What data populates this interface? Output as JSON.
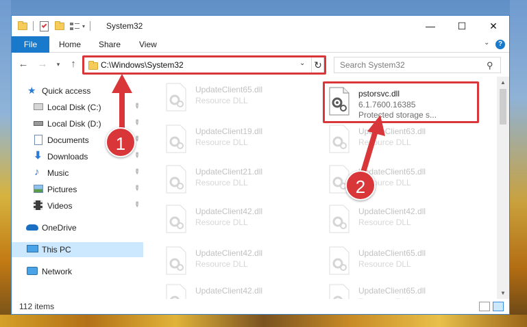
{
  "window": {
    "title": "System32",
    "controls": {
      "minimize": "—",
      "maximize": "☐",
      "close": "✕"
    }
  },
  "ribbon": {
    "tabs": [
      "File",
      "Home",
      "Share",
      "View"
    ],
    "help": "?"
  },
  "navigation": {
    "address": "C:\\Windows\\System32",
    "search_placeholder": "Search System32"
  },
  "sidebar": {
    "items": [
      {
        "label": "Quick access",
        "icon": "star-icon"
      },
      {
        "label": "Local Disk (C:)",
        "icon": "drive-icon",
        "pinned": true
      },
      {
        "label": "Local Disk (D:)",
        "icon": "drive-icon",
        "pinned": true
      },
      {
        "label": "Documents",
        "icon": "documents-icon",
        "pinned": true
      },
      {
        "label": "Downloads",
        "icon": "download-icon",
        "pinned": true
      },
      {
        "label": "Music",
        "icon": "music-icon",
        "pinned": true
      },
      {
        "label": "Pictures",
        "icon": "pictures-icon",
        "pinned": true
      },
      {
        "label": "Videos",
        "icon": "videos-icon",
        "pinned": true
      },
      {
        "label": "OneDrive",
        "icon": "onedrive-icon"
      },
      {
        "label": "This PC",
        "icon": "pc-icon",
        "selected": true
      },
      {
        "label": "Network",
        "icon": "network-icon"
      }
    ]
  },
  "files": {
    "highlighted": {
      "name": "pstorsvc.dll",
      "version": "6.1.7600.16385",
      "description": "Protected storage s..."
    },
    "left_column": [
      {
        "name": "UpdateClient65.dll",
        "type": "Resource DLL"
      },
      {
        "name": "UpdateClient19.dll",
        "type": "Resource DLL"
      },
      {
        "name": "UpdateClient21.dll",
        "type": "Resource DLL"
      },
      {
        "name": "UpdateClient42.dll",
        "type": "Resource DLL"
      },
      {
        "name": "UpdateClient42.dll",
        "type": "Resource DLL"
      },
      {
        "name": "UpdateClient42.dll",
        "type": ""
      }
    ],
    "right_column": [
      {
        "name": "UpdateClient63.dll",
        "type": "Resource DLL"
      },
      {
        "name": "UpdateClient65.dll",
        "type": "Resource DLL"
      },
      {
        "name": "UpdateClient42.dll",
        "type": "Resource DLL"
      },
      {
        "name": "UpdateClient65.dll",
        "type": "Resource DLL"
      },
      {
        "name": "UpdateClient65.dll",
        "type": "Resource DLL"
      }
    ]
  },
  "status": {
    "item_count": "112 items"
  },
  "annotations": {
    "step1": "1",
    "step2": "2",
    "highlight_color": "#d9363a"
  },
  "colors": {
    "accent": "#1979ca",
    "selection": "#cce8ff"
  }
}
